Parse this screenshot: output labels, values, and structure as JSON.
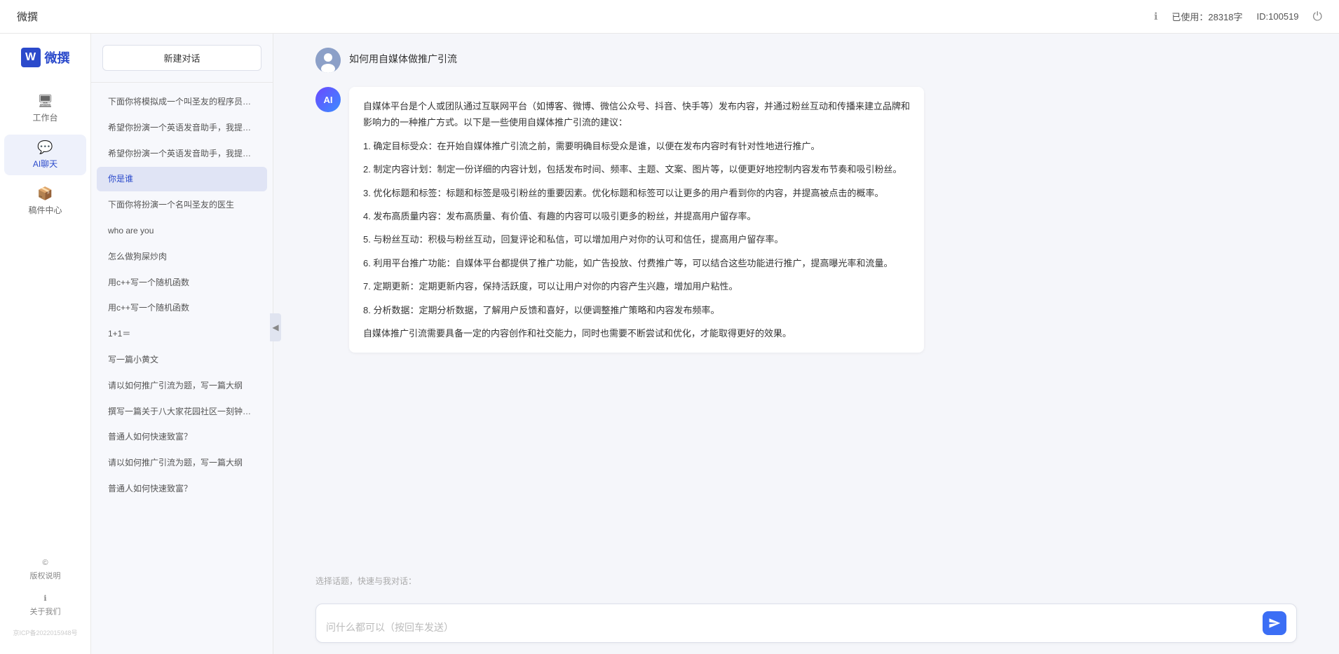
{
  "topbar": {
    "title": "微撰",
    "usage_label": "已使用：28318字",
    "id_label": "ID:100519",
    "info_icon": "ℹ",
    "power_icon": "⏻"
  },
  "logo": {
    "w": "W",
    "text": "微撰"
  },
  "nav": {
    "items": [
      {
        "id": "workbench",
        "icon": "🖥",
        "label": "工作台"
      },
      {
        "id": "ai-chat",
        "icon": "💬",
        "label": "AI聊天"
      },
      {
        "id": "drafts",
        "icon": "📦",
        "label": "稿件中心"
      }
    ],
    "bottom": [
      {
        "id": "copyright",
        "icon": "©",
        "label": "版权说明"
      },
      {
        "id": "about",
        "icon": "ℹ",
        "label": "关于我们"
      }
    ],
    "icp": "京ICP备2022015948号"
  },
  "history": {
    "new_chat_label": "新建对话",
    "items": [
      {
        "id": "h1",
        "text": "下面你将模拟成一个叫圣友的程序员，我说..."
      },
      {
        "id": "h2",
        "text": "希望你扮演一个英语发音助手，我提供给你..."
      },
      {
        "id": "h3",
        "text": "希望你扮演一个英语发音助手，我提供给你..."
      },
      {
        "id": "h4",
        "text": "你是谁",
        "active": true
      },
      {
        "id": "h5",
        "text": "下面你将扮演一个名叫圣友的医生"
      },
      {
        "id": "h6",
        "text": "who are you"
      },
      {
        "id": "h7",
        "text": "怎么做狗屎炒肉"
      },
      {
        "id": "h8",
        "text": "用c++写一个随机函数"
      },
      {
        "id": "h9",
        "text": "用c++写一个随机函数"
      },
      {
        "id": "h10",
        "text": "1+1＝"
      },
      {
        "id": "h11",
        "text": "写一篇小黄文"
      },
      {
        "id": "h12",
        "text": "请以如何推广引流为题，写一篇大纲"
      },
      {
        "id": "h13",
        "text": "撰写一篇关于八大家花园社区一刻钟便民生..."
      },
      {
        "id": "h14",
        "text": "普通人如何快速致富？"
      },
      {
        "id": "h15",
        "text": "请以如何推广引流为题，写一篇大纲"
      },
      {
        "id": "h16",
        "text": "普通人如何快速致富？"
      }
    ]
  },
  "chat": {
    "user_msg": "如何用自媒体做推广引流",
    "ai_intro": "自媒体平台是个人或团队通过互联网平台（如博客、微博、微信公众号、抖音、快手等）发布内容，并通过粉丝互动和传播来建立品牌和影响力的一种推广方式。以下是一些使用自媒体推广引流的建议：",
    "ai_points": [
      "1. 确定目标受众：在开始自媒体推广引流之前，需要明确目标受众是谁，以便在发布内容时有针对性地进行推广。",
      "2. 制定内容计划：制定一份详细的内容计划，包括发布时间、频率、主题、文案、图片等，以便更好地控制内容发布节奏和吸引粉丝。",
      "3. 优化标题和标签：标题和标签是吸引粉丝的重要因素。优化标题和标签可以让更多的用户看到你的内容，并提高被点击的概率。",
      "4. 发布高质量内容：发布高质量、有价值、有趣的内容可以吸引更多的粉丝，并提高用户留存率。",
      "5. 与粉丝互动：积极与粉丝互动，回复评论和私信，可以增加用户对你的认可和信任，提高用户留存率。",
      "6. 利用平台推广功能：自媒体平台都提供了推广功能，如广告投放、付费推广等，可以结合这些功能进行推广，提高曝光率和流量。",
      "7. 定期更新：定期更新内容，保持活跃度，可以让用户对你的内容产生兴趣，增加用户粘性。",
      "8. 分析数据：定期分析数据，了解用户反馈和喜好，以便调整推广策略和内容发布频率。"
    ],
    "ai_conclusion": "自媒体推广引流需要具备一定的内容创作和社交能力，同时也需要不断尝试和优化，才能取得更好的效果。",
    "quick_reply_placeholder": "选择话题，快速与我对话：",
    "input_placeholder": "问什么都可以（按回车发送）"
  }
}
